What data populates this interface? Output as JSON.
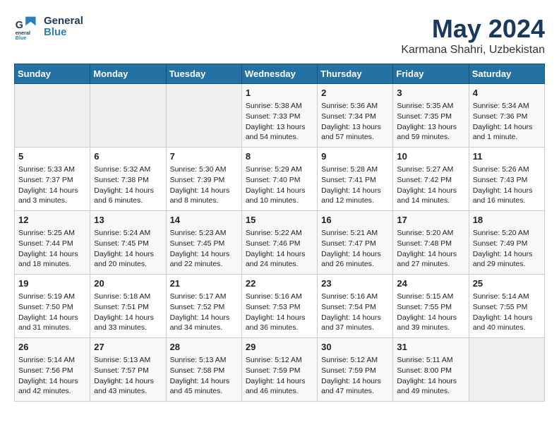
{
  "header": {
    "logo_line1": "General",
    "logo_line2": "Blue",
    "month": "May 2024",
    "location": "Karmana Shahri, Uzbekistan"
  },
  "weekdays": [
    "Sunday",
    "Monday",
    "Tuesday",
    "Wednesday",
    "Thursday",
    "Friday",
    "Saturday"
  ],
  "weeks": [
    [
      {
        "day": "",
        "info": ""
      },
      {
        "day": "",
        "info": ""
      },
      {
        "day": "",
        "info": ""
      },
      {
        "day": "1",
        "info": "Sunrise: 5:38 AM\nSunset: 7:33 PM\nDaylight: 13 hours and 54 minutes."
      },
      {
        "day": "2",
        "info": "Sunrise: 5:36 AM\nSunset: 7:34 PM\nDaylight: 13 hours and 57 minutes."
      },
      {
        "day": "3",
        "info": "Sunrise: 5:35 AM\nSunset: 7:35 PM\nDaylight: 13 hours and 59 minutes."
      },
      {
        "day": "4",
        "info": "Sunrise: 5:34 AM\nSunset: 7:36 PM\nDaylight: 14 hours and 1 minute."
      }
    ],
    [
      {
        "day": "5",
        "info": "Sunrise: 5:33 AM\nSunset: 7:37 PM\nDaylight: 14 hours and 3 minutes."
      },
      {
        "day": "6",
        "info": "Sunrise: 5:32 AM\nSunset: 7:38 PM\nDaylight: 14 hours and 6 minutes."
      },
      {
        "day": "7",
        "info": "Sunrise: 5:30 AM\nSunset: 7:39 PM\nDaylight: 14 hours and 8 minutes."
      },
      {
        "day": "8",
        "info": "Sunrise: 5:29 AM\nSunset: 7:40 PM\nDaylight: 14 hours and 10 minutes."
      },
      {
        "day": "9",
        "info": "Sunrise: 5:28 AM\nSunset: 7:41 PM\nDaylight: 14 hours and 12 minutes."
      },
      {
        "day": "10",
        "info": "Sunrise: 5:27 AM\nSunset: 7:42 PM\nDaylight: 14 hours and 14 minutes."
      },
      {
        "day": "11",
        "info": "Sunrise: 5:26 AM\nSunset: 7:43 PM\nDaylight: 14 hours and 16 minutes."
      }
    ],
    [
      {
        "day": "12",
        "info": "Sunrise: 5:25 AM\nSunset: 7:44 PM\nDaylight: 14 hours and 18 minutes."
      },
      {
        "day": "13",
        "info": "Sunrise: 5:24 AM\nSunset: 7:45 PM\nDaylight: 14 hours and 20 minutes."
      },
      {
        "day": "14",
        "info": "Sunrise: 5:23 AM\nSunset: 7:45 PM\nDaylight: 14 hours and 22 minutes."
      },
      {
        "day": "15",
        "info": "Sunrise: 5:22 AM\nSunset: 7:46 PM\nDaylight: 14 hours and 24 minutes."
      },
      {
        "day": "16",
        "info": "Sunrise: 5:21 AM\nSunset: 7:47 PM\nDaylight: 14 hours and 26 minutes."
      },
      {
        "day": "17",
        "info": "Sunrise: 5:20 AM\nSunset: 7:48 PM\nDaylight: 14 hours and 27 minutes."
      },
      {
        "day": "18",
        "info": "Sunrise: 5:20 AM\nSunset: 7:49 PM\nDaylight: 14 hours and 29 minutes."
      }
    ],
    [
      {
        "day": "19",
        "info": "Sunrise: 5:19 AM\nSunset: 7:50 PM\nDaylight: 14 hours and 31 minutes."
      },
      {
        "day": "20",
        "info": "Sunrise: 5:18 AM\nSunset: 7:51 PM\nDaylight: 14 hours and 33 minutes."
      },
      {
        "day": "21",
        "info": "Sunrise: 5:17 AM\nSunset: 7:52 PM\nDaylight: 14 hours and 34 minutes."
      },
      {
        "day": "22",
        "info": "Sunrise: 5:16 AM\nSunset: 7:53 PM\nDaylight: 14 hours and 36 minutes."
      },
      {
        "day": "23",
        "info": "Sunrise: 5:16 AM\nSunset: 7:54 PM\nDaylight: 14 hours and 37 minutes."
      },
      {
        "day": "24",
        "info": "Sunrise: 5:15 AM\nSunset: 7:55 PM\nDaylight: 14 hours and 39 minutes."
      },
      {
        "day": "25",
        "info": "Sunrise: 5:14 AM\nSunset: 7:55 PM\nDaylight: 14 hours and 40 minutes."
      }
    ],
    [
      {
        "day": "26",
        "info": "Sunrise: 5:14 AM\nSunset: 7:56 PM\nDaylight: 14 hours and 42 minutes."
      },
      {
        "day": "27",
        "info": "Sunrise: 5:13 AM\nSunset: 7:57 PM\nDaylight: 14 hours and 43 minutes."
      },
      {
        "day": "28",
        "info": "Sunrise: 5:13 AM\nSunset: 7:58 PM\nDaylight: 14 hours and 45 minutes."
      },
      {
        "day": "29",
        "info": "Sunrise: 5:12 AM\nSunset: 7:59 PM\nDaylight: 14 hours and 46 minutes."
      },
      {
        "day": "30",
        "info": "Sunrise: 5:12 AM\nSunset: 7:59 PM\nDaylight: 14 hours and 47 minutes."
      },
      {
        "day": "31",
        "info": "Sunrise: 5:11 AM\nSunset: 8:00 PM\nDaylight: 14 hours and 49 minutes."
      },
      {
        "day": "",
        "info": ""
      }
    ]
  ]
}
